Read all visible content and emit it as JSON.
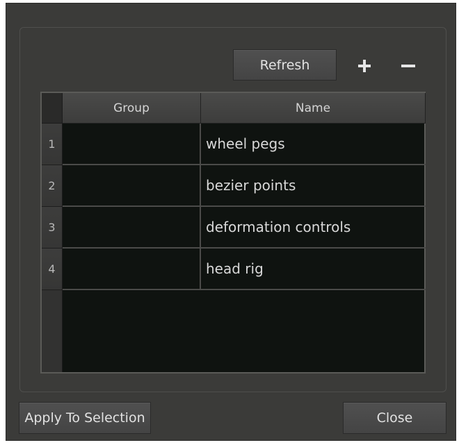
{
  "toolbar": {
    "refresh_label": "Refresh",
    "add_icon": "plus-icon",
    "remove_icon": "minus-icon"
  },
  "table": {
    "columns": [
      "Group",
      "Name"
    ],
    "rows": [
      {
        "num": "1",
        "group": "",
        "name": "wheel pegs"
      },
      {
        "num": "2",
        "group": "",
        "name": "bezier points"
      },
      {
        "num": "3",
        "group": "",
        "name": "deformation controls"
      },
      {
        "num": "4",
        "group": "",
        "name": "head rig"
      }
    ]
  },
  "footer": {
    "apply_label": "Apply To Selection",
    "close_label": "Close"
  },
  "colors": {
    "window_bg": "#3b3b39",
    "table_bg": "#0f1310",
    "text": "#e2e2e2"
  }
}
